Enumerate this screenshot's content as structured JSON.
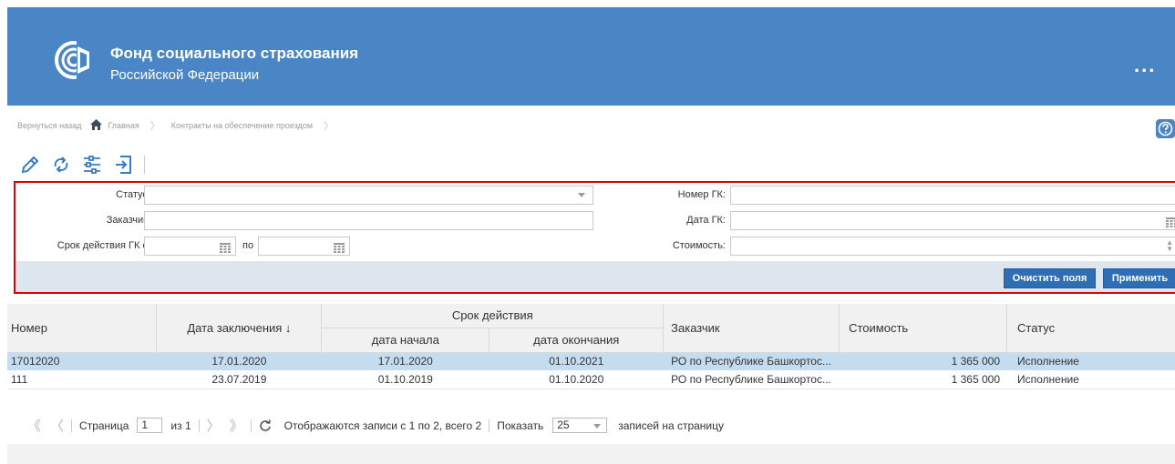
{
  "header": {
    "title": "Фонд социального страхования",
    "subtitle": "Российской Федерации",
    "menu_icon": "more-dots-icon",
    "menu_label": "..."
  },
  "breadcrumb": {
    "back": "Вернуться назад",
    "home": "Главная",
    "current": "Контракты на обеспечение проездом"
  },
  "toolbar": {
    "icons": [
      "edit-icon",
      "refresh-icon",
      "filter-settings-icon",
      "export-icon"
    ]
  },
  "filter": {
    "status_label": "Статус:",
    "status_value": "",
    "customer_label": "Заказчик:",
    "customer_value": "",
    "term_from_label": "Срок действия ГК с:",
    "term_to_label": "по",
    "term_from_value": "",
    "term_to_value": "",
    "gk_number_label": "Номер ГК:",
    "gk_number_value": "",
    "gk_date_label": "Дата ГК:",
    "gk_date_value": "",
    "cost_label": "Стоимость:",
    "cost_value": "",
    "clear_button": "Очистить поля",
    "apply_button": "Применить"
  },
  "table": {
    "headers": {
      "number": "Номер",
      "date": "Дата заключения ↓",
      "term_group": "Срок действия",
      "term_start": "дата начала",
      "term_end": "дата окончания",
      "customer": "Заказчик",
      "cost": "Стоимость",
      "status": "Статус"
    },
    "rows": [
      {
        "number": "17012020",
        "date": "17.01.2020",
        "start": "17.01.2020",
        "end": "01.10.2021",
        "customer": "РО по Республике Башкортос...",
        "cost": "1 365 000",
        "status": "Исполнение"
      },
      {
        "number": "111",
        "date": "23.07.2019",
        "start": "01.10.2019",
        "end": "01.10.2020",
        "customer": "РО по Республике Башкортос...",
        "cost": "1 365 000",
        "status": "Исполнение"
      }
    ]
  },
  "pager": {
    "page_label": "Страница",
    "page_value": "1",
    "of_label": "из 1",
    "records_info": "Отображаются записи с 1 по 2, всего 2",
    "show_label": "Показать",
    "page_size": "25",
    "per_page_label": "записей на страницу"
  },
  "colors": {
    "header_bg": "#4a86c6",
    "accent_button": "#2f6eb5",
    "selected_row": "#c4dcf0",
    "filter_border": "#e00000"
  }
}
